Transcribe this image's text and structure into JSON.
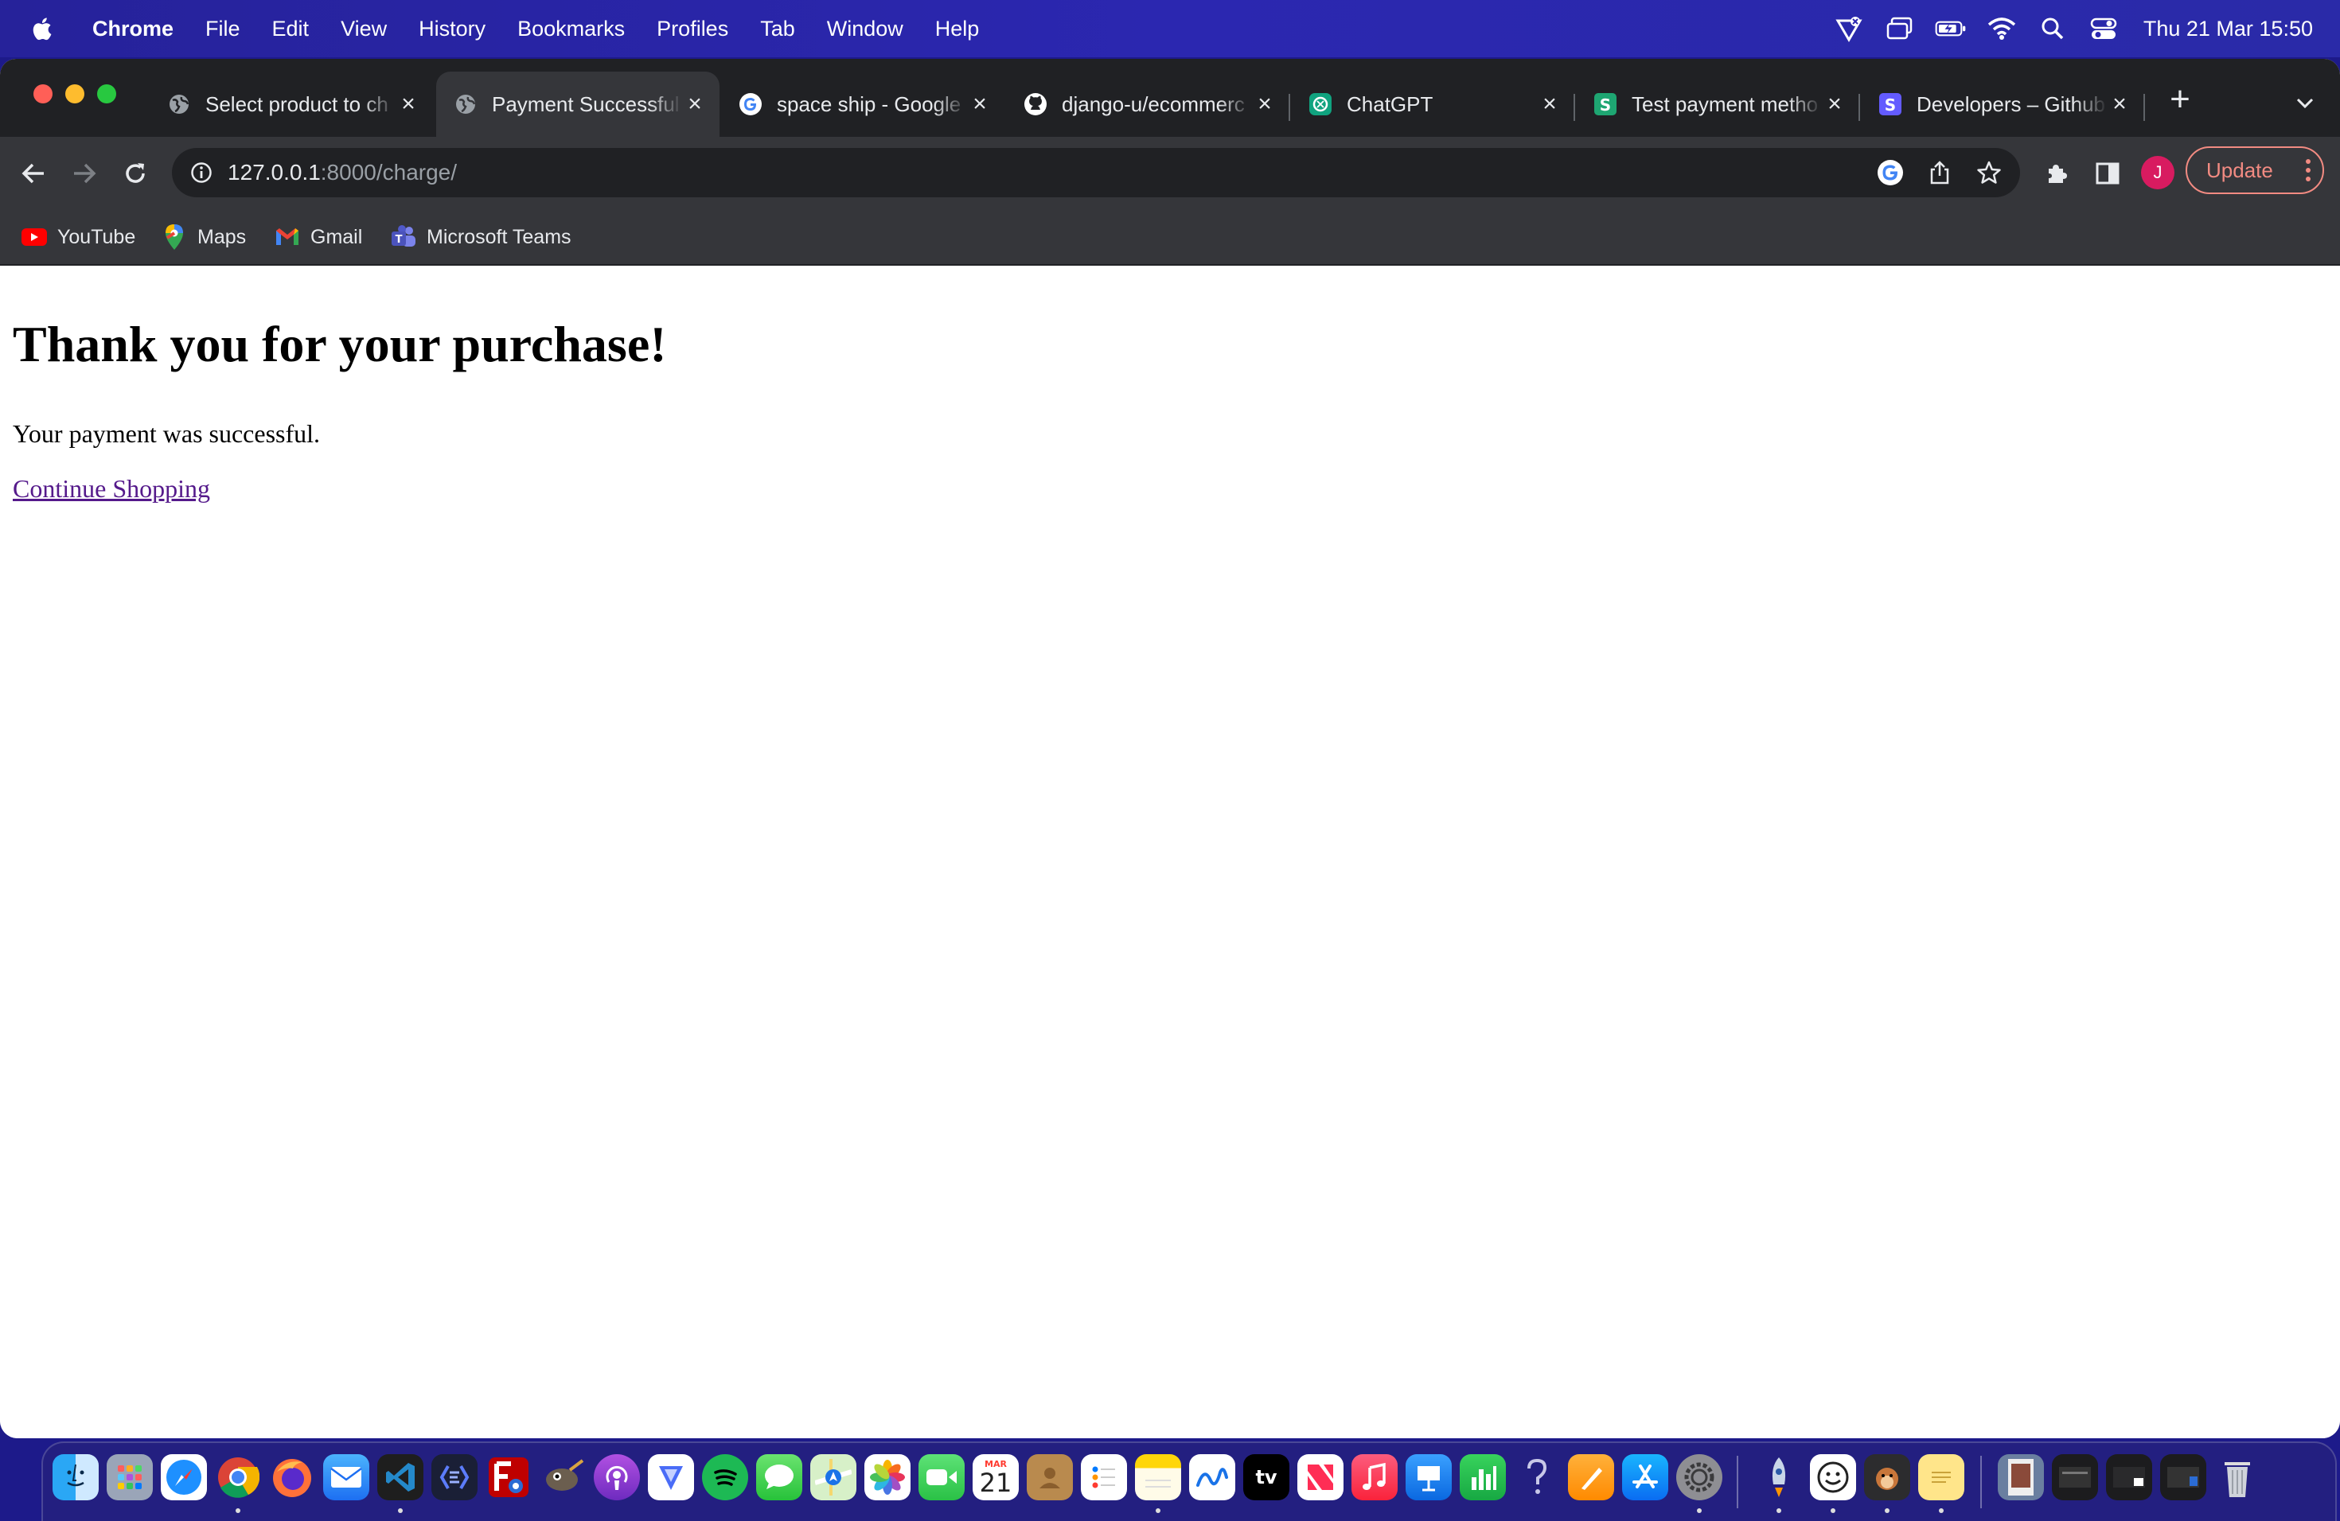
{
  "menubar": {
    "app_name": "Chrome",
    "menus": [
      "File",
      "Edit",
      "View",
      "History",
      "Bookmarks",
      "Profiles",
      "Tab",
      "Window",
      "Help"
    ],
    "clock": "Thu 21 Mar  15:50",
    "status_icons": [
      "vpn-shield-icon",
      "screen-mirroring-icon",
      "battery-icon",
      "wifi-icon",
      "spotlight-search-icon",
      "control-center-icon"
    ]
  },
  "tabs": [
    {
      "title": "Select product to ch",
      "favicon": "globe-icon",
      "active": false
    },
    {
      "title": "Payment Successful",
      "favicon": "globe-icon",
      "active": true
    },
    {
      "title": "space ship - Google",
      "favicon": "google-icon",
      "active": false
    },
    {
      "title": "django-u/ecommerc",
      "favicon": "github-icon",
      "active": false
    },
    {
      "title": "ChatGPT",
      "favicon": "chatgpt-icon",
      "active": false
    },
    {
      "title": "Test payment metho",
      "favicon": "stripe-green-icon",
      "active": false
    },
    {
      "title": "Developers – Github",
      "favicon": "stripe-icon",
      "active": false
    }
  ],
  "tab_close_glyph": "×",
  "new_tab_glyph": "+",
  "address_bar": {
    "host": "127.0.0.1",
    "rest": ":8000/charge/"
  },
  "profile_initial": "J",
  "update_label": "Update",
  "bookmarks": [
    {
      "label": "YouTube",
      "icon": "youtube-icon"
    },
    {
      "label": "Maps",
      "icon": "maps-icon"
    },
    {
      "label": "Gmail",
      "icon": "gmail-icon"
    },
    {
      "label": "Microsoft Teams",
      "icon": "teams-icon"
    }
  ],
  "page": {
    "heading": "Thank you for your purchase!",
    "message": "Your payment was successful.",
    "link": "Continue Shopping"
  },
  "dock": {
    "apps": [
      "Finder",
      "Launchpad",
      "Safari",
      "Chrome",
      "Firefox",
      "Mail",
      "VS Code",
      "Xcode-like",
      "FileZilla",
      "GIMP",
      "Podcast",
      "Vectornator",
      "Spotify",
      "Messages",
      "Maps",
      "Photos",
      "FaceTime",
      "Calendar",
      "Contacts",
      "Reminders",
      "Notes",
      "Freeform",
      "TV",
      "News",
      "Music",
      "Keynote",
      "Numbers",
      "Tips",
      "Pages",
      "App Store",
      "System Settings",
      "Rocket",
      "Finder Face",
      "Monkey",
      "Stickies",
      "Preview",
      "Windows",
      "Downloads",
      "Trash"
    ],
    "calendar_month": "MAR",
    "calendar_day": "21",
    "tv_label": "tv"
  }
}
